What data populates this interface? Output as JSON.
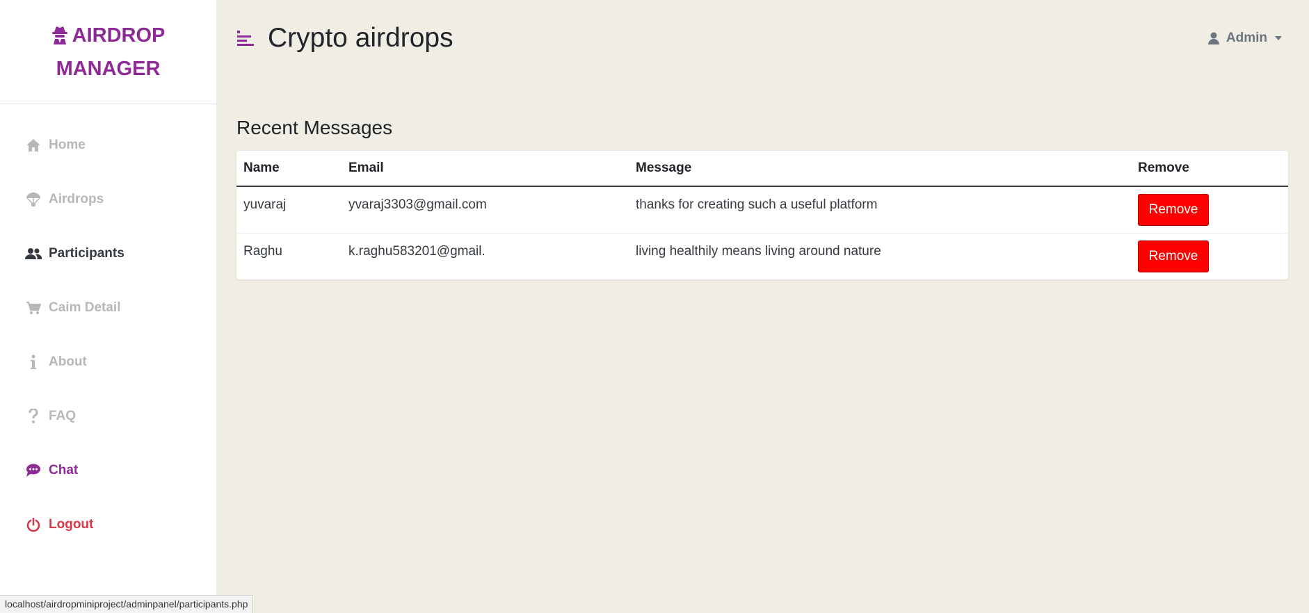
{
  "brand": {
    "line1": "AIRDROP",
    "line2": "MANAGER",
    "icon": "user-secret-icon",
    "color": "#8e2a96"
  },
  "sidebar": {
    "items": [
      {
        "label": "Home",
        "icon": "home-icon",
        "state": "muted"
      },
      {
        "label": "Airdrops",
        "icon": "parachute-icon",
        "state": "muted"
      },
      {
        "label": "Participants",
        "icon": "users-icon",
        "state": "active"
      },
      {
        "label": "Caim Detail",
        "icon": "cart-icon",
        "state": "muted"
      },
      {
        "label": "About",
        "icon": "info-icon",
        "state": "muted"
      },
      {
        "label": "FAQ",
        "icon": "question-icon",
        "state": "muted"
      },
      {
        "label": "Chat",
        "icon": "chat-icon",
        "state": "accent"
      },
      {
        "label": "Logout",
        "icon": "power-icon",
        "state": "danger"
      }
    ]
  },
  "header": {
    "title": "Crypto airdrops",
    "menu_icon": "align-left-icon",
    "user": {
      "label": "Admin",
      "icon": "user-icon"
    }
  },
  "main": {
    "section_title": "Recent Messages",
    "table": {
      "columns": [
        "Name",
        "Email",
        "Message",
        "Remove"
      ],
      "rows": [
        {
          "name": "yuvaraj",
          "email": "yvaraj3303@gmail.com",
          "message": "thanks for creating such a useful platform",
          "action": "Remove"
        },
        {
          "name": "Raghu",
          "email": "k.raghu583201@gmail.",
          "message": "living healthily means living around nature",
          "action": "Remove"
        }
      ]
    }
  },
  "statusbar": {
    "url": "localhost/airdropminiproject/adminpanel/participants.php"
  },
  "colors": {
    "accent": "#8e2a96",
    "danger": "#dc3545",
    "button": "#ff0000",
    "background": "#efede4"
  }
}
